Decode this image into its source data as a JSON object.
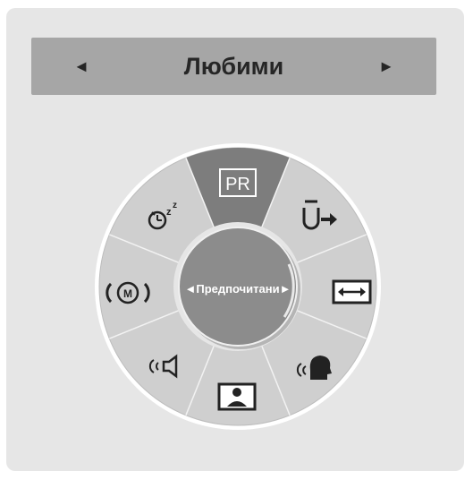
{
  "header": {
    "title": "Любими",
    "prev_arrow": "◄",
    "next_arrow": "►"
  },
  "wheel": {
    "selected_segment": "PR",
    "center_label": "Предпочитани",
    "center_prev": "◄",
    "center_next": "►",
    "items": [
      {
        "name": "pr",
        "icon": "pr-icon",
        "label": "PR"
      },
      {
        "name": "input",
        "icon": "input-icon"
      },
      {
        "name": "aspect-ratio",
        "icon": "aspect-ratio-icon"
      },
      {
        "name": "voice",
        "icon": "voice-icon"
      },
      {
        "name": "picture",
        "icon": "picture-icon"
      },
      {
        "name": "sound",
        "icon": "sound-icon"
      },
      {
        "name": "sound-mode",
        "icon": "sound-mode-icon",
        "label": "M"
      },
      {
        "name": "sleep-timer",
        "icon": "sleep-timer-icon",
        "label": "z"
      }
    ]
  },
  "colors": {
    "panel": "#e6e6e6",
    "header": "#a6a6a6",
    "wheel": "#cfcfcf",
    "selected": "#7d7d7d",
    "center": "#8c8c8c",
    "text": "#262626"
  }
}
